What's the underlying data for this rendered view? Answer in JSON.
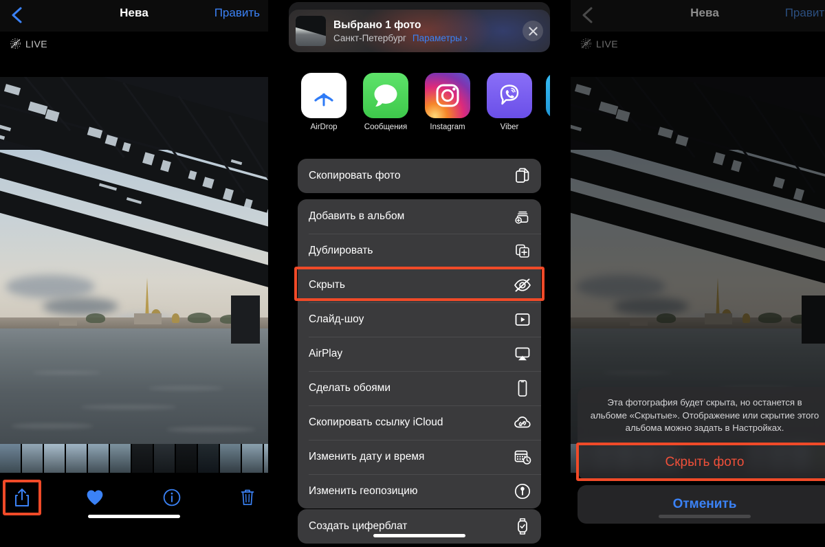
{
  "panels": {
    "left": {
      "navbar": {
        "title": "Нева",
        "edit_label": "Править",
        "back_icon": "chevron-left-icon"
      },
      "live_badge": {
        "label": "LIVE",
        "icon": "live-photo-off-icon"
      },
      "toolbar": {
        "share_icon": "share-icon",
        "favorite_icon": "heart-filled-icon",
        "info_icon": "info-circle-icon",
        "delete_icon": "trash-icon"
      },
      "highlight_color": "#f04a28"
    },
    "middle": {
      "header": {
        "title": "Выбрано 1 фото",
        "location": "Санкт-Петербург",
        "options_label": "Параметры ›",
        "close_icon": "close-icon",
        "thumbnail": "photo-thumbnail"
      },
      "apps": [
        {
          "label": "AirDrop",
          "icon": "airdrop-icon",
          "color": "#ffffff"
        },
        {
          "label": "Сообщения",
          "icon": "messages-icon",
          "color": "#4cd964"
        },
        {
          "label": "Instagram",
          "icon": "instagram-icon",
          "color": "#c13584"
        },
        {
          "label": "Viber",
          "icon": "viber-icon",
          "color": "#7360f2"
        },
        {
          "label": "",
          "icon": "telegram-icon",
          "color": "#2aabee"
        }
      ],
      "menu_groups": [
        {
          "items": [
            {
              "label": "Скопировать фото",
              "icon": "copy-icon",
              "highlighted": false
            }
          ]
        },
        {
          "items": [
            {
              "label": "Добавить в альбом",
              "icon": "add-to-album-icon",
              "highlighted": false
            },
            {
              "label": "Дублировать",
              "icon": "duplicate-icon",
              "highlighted": false
            },
            {
              "label": "Скрыть",
              "icon": "eye-slash-icon",
              "highlighted": true
            },
            {
              "label": "Слайд-шоу",
              "icon": "slideshow-icon",
              "highlighted": false
            },
            {
              "label": "AirPlay",
              "icon": "airplay-icon",
              "highlighted": false
            },
            {
              "label": "Сделать обоями",
              "icon": "wallpaper-icon",
              "highlighted": false
            },
            {
              "label": "Скопировать ссылку iCloud",
              "icon": "icloud-link-icon",
              "highlighted": false
            },
            {
              "label": "Изменить дату и время",
              "icon": "calendar-clock-icon",
              "highlighted": false
            },
            {
              "label": "Изменить геопозицию",
              "icon": "location-icon",
              "highlighted": false
            }
          ]
        },
        {
          "items": [
            {
              "label": "Создать циферблат",
              "icon": "watch-face-icon",
              "highlighted": false
            }
          ]
        }
      ]
    },
    "right": {
      "navbar": {
        "title": "Нева",
        "edit_label": "Править",
        "back_icon": "chevron-left-icon"
      },
      "live_badge": {
        "label": "LIVE",
        "icon": "live-photo-off-icon"
      },
      "action_sheet": {
        "message": "Эта фотография будет скрыта, но останется в альбоме «Скрытые». Отображение или скрытие этого альбома можно задать в Настройках.",
        "destructive_label": "Скрыть фото",
        "cancel_label": "Отменить",
        "destructive_color": "#f0503a",
        "cancel_color": "#3b82f6",
        "highlight_color": "#f04a28"
      }
    }
  }
}
